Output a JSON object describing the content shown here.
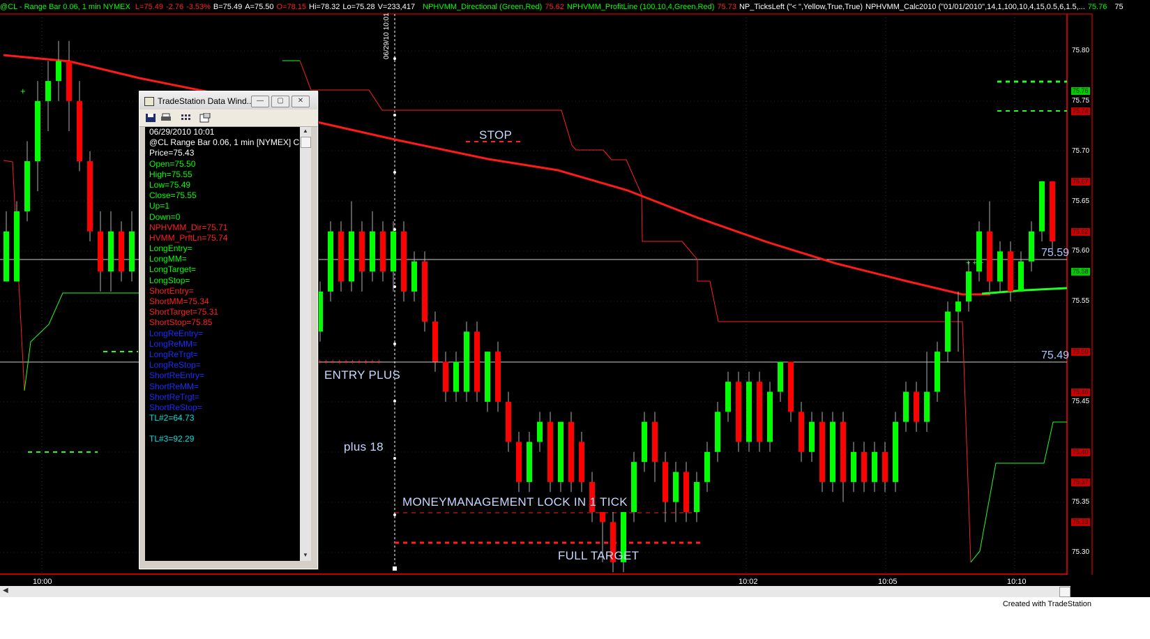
{
  "header": {
    "symbol": "@CL - Range Bar 0.06, 1 min  NYMEX",
    "quote": [
      {
        "text": "L=75.49",
        "color": "#ff2020"
      },
      {
        "text": "-2.76",
        "color": "#ff2020"
      },
      {
        "text": "-3.53%",
        "color": "#ff2020"
      },
      {
        "text": "B=75.49",
        "color": "#ffffff"
      },
      {
        "text": "A=75.50",
        "color": "#ffffff"
      },
      {
        "text": "O=78.15",
        "color": "#ff2020"
      },
      {
        "text": "Hi=78.32",
        "color": "#ffffff"
      },
      {
        "text": "Lo=75.28",
        "color": "#ffffff"
      },
      {
        "text": "V=233,417",
        "color": "#ffffff"
      }
    ],
    "indicators": [
      {
        "name": "NPHVMM_Directional (Green,Red)",
        "value": "75.62",
        "name_color": "#00ff00",
        "value_color": "#ff2020"
      },
      {
        "name": "NPHVMM_ProfitLine (100,10,4,Green,Red)",
        "value": "75.73",
        "name_color": "#00ff00",
        "value_color": "#ff2020"
      },
      {
        "name": "NP_TicksLeft (\"< \",Yellow,True,True)",
        "value": "",
        "name_color": "#ffffff",
        "value_color": "#ffffff"
      },
      {
        "name": "NPHVMM_Calc2010 (\"01/01/2010\",14,1,100,10,4,15,0.5,6,1.5,...",
        "value": "75.76",
        "name_color": "#ffffff",
        "value_color": "#00ff00"
      }
    ],
    "trailing": "75"
  },
  "price_axis": {
    "ticks": [
      "75.80",
      "75.75",
      "75.70",
      "75.65",
      "75.60",
      "75.55",
      "75.50",
      "75.45",
      "75.40",
      "75.35",
      "75.30"
    ],
    "boxes": [
      {
        "label": "75.76",
        "color": "#00cc00"
      },
      {
        "label": "75.74",
        "color": "#cc0000"
      },
      {
        "label": "75.67",
        "color": "#cc0000"
      },
      {
        "label": "75.62",
        "color": "#cc0000"
      },
      {
        "label": "75.58",
        "color": "#00cc00"
      },
      {
        "label": "75.50",
        "color": "#cc0000"
      },
      {
        "label": "75.46",
        "color": "#cc0000"
      },
      {
        "label": "75.40",
        "color": "#cc0000"
      },
      {
        "label": "75.37",
        "color": "#cc0000"
      },
      {
        "label": "75.33",
        "color": "#cc0000"
      }
    ]
  },
  "time_axis": [
    "10:00",
    "10:02",
    "10:05",
    "10:10"
  ],
  "cursor_date": "06/29/10 10:01",
  "annotations": {
    "stop": "STOP",
    "entry_plus": "ENTRY PLUS",
    "plus_18": "plus 18",
    "moneymanagement": "MONEYMANAGEMENT LOCK IN 1 TICK",
    "full_target": "FULL TARGET",
    "level_upper": "75.59",
    "level_lower": "75.49"
  },
  "data_window": {
    "title": "TradeStation Data Wind...",
    "lines": [
      {
        "text": "06/29/2010 10:01",
        "color": "#ffffff"
      },
      {
        "text": "@CL Range Bar 0.06, 1 min [NYMEX] C",
        "color": "#ffffff"
      },
      {
        "text": "Price=75.43",
        "color": "#ffffff"
      },
      {
        "text": "Open=75.50",
        "color": "#00ff00"
      },
      {
        "text": "High=75.55",
        "color": "#00ff00"
      },
      {
        "text": "Low=75.49",
        "color": "#00ff00"
      },
      {
        "text": "Close=75.55",
        "color": "#00ff00"
      },
      {
        "text": "Up=1",
        "color": "#00ff00"
      },
      {
        "text": "Down=0",
        "color": "#00ff00"
      },
      {
        "text": "NPHVMM_Dir=75.71",
        "color": "#ff2020"
      },
      {
        "text": "HVMM_PrftLn=75.74",
        "color": "#ff2020"
      },
      {
        "text": "LongEntry=",
        "color": "#00ff00"
      },
      {
        "text": "LongMM=",
        "color": "#00ff00"
      },
      {
        "text": "LongTarget=",
        "color": "#00ff00"
      },
      {
        "text": "LongStop=",
        "color": "#00ff00"
      },
      {
        "text": "ShortEntry=",
        "color": "#ff2020"
      },
      {
        "text": "ShortMM=75.34",
        "color": "#ff2020"
      },
      {
        "text": "ShortTarget=75.31",
        "color": "#ff2020"
      },
      {
        "text": "ShortStop=75.85",
        "color": "#ff2020"
      },
      {
        "text": "LongReEntry=",
        "color": "#1a2cff"
      },
      {
        "text": "LongReMM=",
        "color": "#1a2cff"
      },
      {
        "text": "LongReTrgt=",
        "color": "#1a2cff"
      },
      {
        "text": "LongReStop=",
        "color": "#1a2cff"
      },
      {
        "text": "ShortReEntry=",
        "color": "#1a2cff"
      },
      {
        "text": "ShortReMM=",
        "color": "#1a2cff"
      },
      {
        "text": "ShortReTrgt=",
        "color": "#1a2cff"
      },
      {
        "text": "ShortReStop=",
        "color": "#1a2cff"
      },
      {
        "text": "TL#2=64.73",
        "color": "#00e0e0"
      },
      {
        "text": "",
        "color": "#00e0e0"
      },
      {
        "text": "TL#3=92.29",
        "color": "#00e0e0"
      }
    ]
  },
  "footer": {
    "credit": "Created with TradeStation"
  },
  "colors": {
    "up": "#00ff00",
    "down": "#ff0000",
    "axis": "#ff0000",
    "background": "#000000"
  },
  "chart_data": {
    "type": "candlestick",
    "y_range": [
      75.28,
      75.82
    ],
    "candles": [
      {
        "o": 75.57,
        "c": 75.62,
        "h": 75.64,
        "l": 75.57
      },
      {
        "o": 75.57,
        "c": 75.64,
        "h": 75.65,
        "l": 75.57
      },
      {
        "o": 75.64,
        "c": 75.69,
        "h": 75.71,
        "l": 75.63
      },
      {
        "o": 75.69,
        "c": 75.75,
        "h": 75.77,
        "l": 75.66
      },
      {
        "o": 75.75,
        "c": 75.77,
        "h": 75.79,
        "l": 75.72
      },
      {
        "o": 75.77,
        "c": 75.79,
        "h": 75.81,
        "l": 75.75
      },
      {
        "o": 75.79,
        "c": 75.75,
        "h": 75.81,
        "l": 75.72
      },
      {
        "o": 75.75,
        "c": 75.69,
        "h": 75.77,
        "l": 75.68
      },
      {
        "o": 75.69,
        "c": 75.62,
        "h": 75.7,
        "l": 75.61
      },
      {
        "o": 75.62,
        "c": 75.58,
        "h": 75.64,
        "l": 75.56
      },
      {
        "o": 75.58,
        "c": 75.62,
        "h": 75.64,
        "l": 75.56
      },
      {
        "o": 75.62,
        "c": 75.58,
        "h": 75.63,
        "l": 75.57
      },
      {
        "o": 75.58,
        "c": 75.62,
        "h": 75.64,
        "l": 75.57
      },
      {
        "o": 75.62,
        "c": 75.58,
        "h": 75.63,
        "l": 75.57
      },
      {
        "o": 75.52,
        "c": 75.56,
        "h": 75.57,
        "l": 75.5
      },
      {
        "o": 75.56,
        "c": 75.59,
        "h": 75.6,
        "l": 75.55
      },
      {
        "o": 75.59,
        "c": 75.55,
        "h": 75.6,
        "l": 75.54
      },
      {
        "o": 75.55,
        "c": 75.52,
        "h": 75.56,
        "l": 75.5
      },
      {
        "o": 75.52,
        "c": 75.56,
        "h": 75.57,
        "l": 75.51
      },
      {
        "o": 75.56,
        "c": 75.52,
        "h": 75.57,
        "l": 75.5
      },
      {
        "o": 75.52,
        "c": 75.56,
        "h": 75.57,
        "l": 75.5
      },
      {
        "o": 75.56,
        "c": 75.52,
        "h": 75.57,
        "l": 75.49
      },
      {
        "o": 75.5,
        "c": 75.55,
        "h": 75.55,
        "l": 75.49
      },
      {
        "o": 75.55,
        "c": 75.52,
        "h": 75.56,
        "l": 75.5
      },
      {
        "o": 75.52,
        "c": 75.55,
        "h": 75.56,
        "l": 75.5
      },
      {
        "o": 75.55,
        "c": 75.5,
        "h": 75.56,
        "l": 75.49
      },
      {
        "o": 75.5,
        "c": 75.54,
        "h": 75.55,
        "l": 75.49
      },
      {
        "o": 75.54,
        "c": 75.5,
        "h": 75.55,
        "l": 75.48
      },
      {
        "o": 75.5,
        "c": 75.54,
        "h": 75.55,
        "l": 75.48
      },
      {
        "o": 75.54,
        "c": 75.52,
        "h": 75.55,
        "l": 75.5
      },
      {
        "o": 75.52,
        "c": 75.56,
        "h": 75.57,
        "l": 75.51
      },
      {
        "o": 75.56,
        "c": 75.62,
        "h": 75.63,
        "l": 75.55
      },
      {
        "o": 75.62,
        "c": 75.57,
        "h": 75.63,
        "l": 75.56
      },
      {
        "o": 75.57,
        "c": 75.62,
        "h": 75.65,
        "l": 75.56
      },
      {
        "o": 75.62,
        "c": 75.58,
        "h": 75.63,
        "l": 75.56
      },
      {
        "o": 75.58,
        "c": 75.62,
        "h": 75.64,
        "l": 75.57
      },
      {
        "o": 75.62,
        "c": 75.58,
        "h": 75.63,
        "l": 75.57
      },
      {
        "o": 75.58,
        "c": 75.62,
        "h": 75.63,
        "l": 75.56
      },
      {
        "o": 75.62,
        "c": 75.56,
        "h": 75.63,
        "l": 75.55
      },
      {
        "o": 75.56,
        "c": 75.59,
        "h": 75.6,
        "l": 75.55
      },
      {
        "o": 75.59,
        "c": 75.53,
        "h": 75.6,
        "l": 75.52
      },
      {
        "o": 75.53,
        "c": 75.49,
        "h": 75.54,
        "l": 75.48
      },
      {
        "o": 75.49,
        "c": 75.46,
        "h": 75.5,
        "l": 75.45
      },
      {
        "o": 75.46,
        "c": 75.49,
        "h": 75.5,
        "l": 75.45
      },
      {
        "o": 75.46,
        "c": 75.52,
        "h": 75.53,
        "l": 75.45
      },
      {
        "o": 75.52,
        "c": 75.46,
        "h": 75.53,
        "l": 75.45
      },
      {
        "o": 75.45,
        "c": 75.5,
        "h": 75.5,
        "l": 75.44
      },
      {
        "o": 75.5,
        "c": 75.45,
        "h": 75.51,
        "l": 75.44
      },
      {
        "o": 75.45,
        "c": 75.41,
        "h": 75.46,
        "l": 75.4
      },
      {
        "o": 75.41,
        "c": 75.37,
        "h": 75.42,
        "l": 75.36
      },
      {
        "o": 75.37,
        "c": 75.41,
        "h": 75.42,
        "l": 75.36
      },
      {
        "o": 75.41,
        "c": 75.43,
        "h": 75.44,
        "l": 75.4
      },
      {
        "o": 75.43,
        "c": 75.37,
        "h": 75.44,
        "l": 75.36
      },
      {
        "o": 75.37,
        "c": 75.43,
        "h": 75.43,
        "l": 75.36
      },
      {
        "o": 75.43,
        "c": 75.37,
        "h": 75.44,
        "l": 75.36
      },
      {
        "o": 75.41,
        "c": 75.37,
        "h": 75.42,
        "l": 75.36
      },
      {
        "o": 75.37,
        "c": 75.34,
        "h": 75.38,
        "l": 75.33
      },
      {
        "o": 75.34,
        "c": 75.33,
        "h": 75.34,
        "l": 75.29
      },
      {
        "o": 75.33,
        "c": 75.29,
        "h": 75.34,
        "l": 75.28
      },
      {
        "o": 75.29,
        "c": 75.34,
        "h": 75.34,
        "l": 75.28
      },
      {
        "o": 75.34,
        "c": 75.39,
        "h": 75.4,
        "l": 75.33
      },
      {
        "o": 75.39,
        "c": 75.43,
        "h": 75.44,
        "l": 75.38
      },
      {
        "o": 75.43,
        "c": 75.39,
        "h": 75.44,
        "l": 75.37
      },
      {
        "o": 75.39,
        "c": 75.35,
        "h": 75.4,
        "l": 75.33
      },
      {
        "o": 75.35,
        "c": 75.38,
        "h": 75.39,
        "l": 75.33
      },
      {
        "o": 75.38,
        "c": 75.34,
        "h": 75.39,
        "l": 75.33
      },
      {
        "o": 75.34,
        "c": 75.37,
        "h": 75.38,
        "l": 75.33
      },
      {
        "o": 75.37,
        "c": 75.4,
        "h": 75.41,
        "l": 75.36
      },
      {
        "o": 75.4,
        "c": 75.44,
        "h": 75.45,
        "l": 75.39
      },
      {
        "o": 75.44,
        "c": 75.47,
        "h": 75.48,
        "l": 75.43
      },
      {
        "o": 75.47,
        "c": 75.41,
        "h": 75.48,
        "l": 75.4
      },
      {
        "o": 75.41,
        "c": 75.47,
        "h": 75.48,
        "l": 75.4
      },
      {
        "o": 75.47,
        "c": 75.41,
        "h": 75.48,
        "l": 75.4
      },
      {
        "o": 75.41,
        "c": 75.46,
        "h": 75.47,
        "l": 75.4
      },
      {
        "o": 75.46,
        "c": 75.49,
        "h": 75.49,
        "l": 75.45
      },
      {
        "o": 75.49,
        "c": 75.44,
        "h": 75.49,
        "l": 75.43
      },
      {
        "o": 75.44,
        "c": 75.4,
        "h": 75.45,
        "l": 75.39
      },
      {
        "o": 75.4,
        "c": 75.43,
        "h": 75.44,
        "l": 75.39
      },
      {
        "o": 75.43,
        "c": 75.37,
        "h": 75.44,
        "l": 75.36
      },
      {
        "o": 75.37,
        "c": 75.43,
        "h": 75.44,
        "l": 75.36
      },
      {
        "o": 75.43,
        "c": 75.37,
        "h": 75.44,
        "l": 75.35
      },
      {
        "o": 75.37,
        "c": 75.4,
        "h": 75.41,
        "l": 75.36
      },
      {
        "o": 75.4,
        "c": 75.37,
        "h": 75.41,
        "l": 75.36
      },
      {
        "o": 75.37,
        "c": 75.4,
        "h": 75.41,
        "l": 75.36
      },
      {
        "o": 75.4,
        "c": 75.37,
        "h": 75.41,
        "l": 75.36
      },
      {
        "o": 75.37,
        "c": 75.43,
        "h": 75.44,
        "l": 75.36
      },
      {
        "o": 75.43,
        "c": 75.46,
        "h": 75.47,
        "l": 75.42
      },
      {
        "o": 75.46,
        "c": 75.43,
        "h": 75.47,
        "l": 75.42
      },
      {
        "o": 75.43,
        "c": 75.46,
        "h": 75.5,
        "l": 75.42
      },
      {
        "o": 75.46,
        "c": 75.5,
        "h": 75.51,
        "l": 75.45
      },
      {
        "o": 75.5,
        "c": 75.54,
        "h": 75.55,
        "l": 75.49
      },
      {
        "o": 75.54,
        "c": 75.55,
        "h": 75.56,
        "l": 75.5
      },
      {
        "o": 75.55,
        "c": 75.58,
        "h": 75.59,
        "l": 75.54
      },
      {
        "o": 75.58,
        "c": 75.62,
        "h": 75.63,
        "l": 75.57
      },
      {
        "o": 75.62,
        "c": 75.57,
        "h": 75.65,
        "l": 75.56
      },
      {
        "o": 75.57,
        "c": 75.6,
        "h": 75.61,
        "l": 75.56
      },
      {
        "o": 75.6,
        "c": 75.56,
        "h": 75.61,
        "l": 75.55
      },
      {
        "o": 75.56,
        "c": 75.59,
        "h": 75.6,
        "l": 75.56
      },
      {
        "o": 75.59,
        "c": 75.62,
        "h": 75.63,
        "l": 75.58
      },
      {
        "o": 75.62,
        "c": 75.67,
        "h": 75.67,
        "l": 75.61
      },
      {
        "o": 75.67,
        "c": 75.61,
        "h": 75.67,
        "l": 75.6
      }
    ]
  }
}
